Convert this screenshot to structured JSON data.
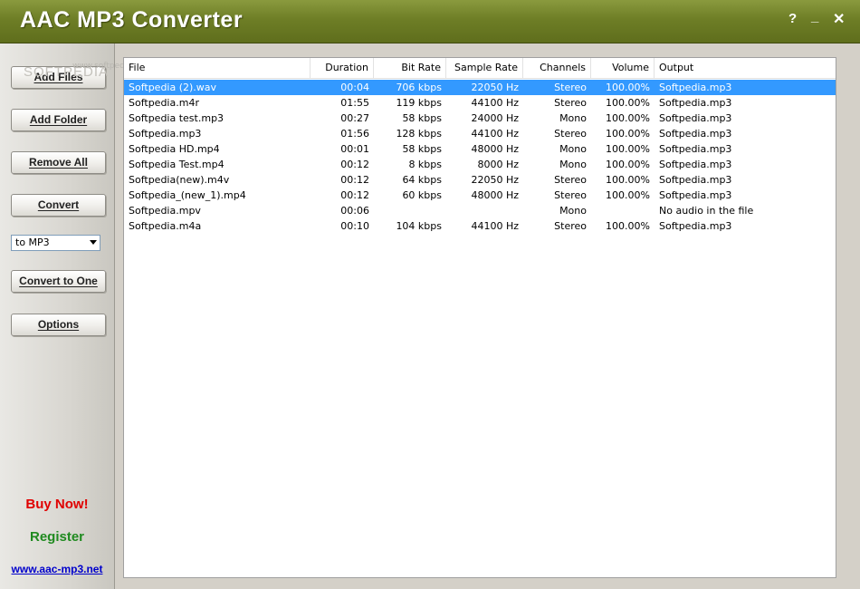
{
  "window": {
    "title": "AAC MP3 Converter",
    "help_label": "?",
    "minimize_label": "_",
    "close_label": "✕"
  },
  "sidebar": {
    "watermark": "SOFTPEDIA",
    "watermark_small": "www.softpedia.com",
    "buttons": {
      "add_files": "Add Files",
      "add_folder": "Add Folder",
      "remove_all": "Remove All",
      "convert": "Convert",
      "convert_to_one": "Convert to One",
      "options": "Options"
    },
    "format_select": {
      "selected": "to MP3"
    },
    "buy_now": "Buy Now!",
    "register": "Register",
    "website": "www.aac-mp3.net",
    "colors": {
      "buy_now": "#e00000",
      "register": "#1f8a1f",
      "link": "#0000cc"
    }
  },
  "file_list": {
    "columns": {
      "file": "File",
      "duration": "Duration",
      "bit_rate": "Bit Rate",
      "sample_rate": "Sample Rate",
      "channels": "Channels",
      "volume": "Volume",
      "output": "Output"
    },
    "rows": [
      {
        "file": "Softpedia (2).wav",
        "duration": "00:04",
        "bit_rate": "706 kbps",
        "sample_rate": "22050 Hz",
        "channels": "Stereo",
        "volume": "100.00%",
        "output": "Softpedia.mp3"
      },
      {
        "file": "Softpedia.m4r",
        "duration": "01:55",
        "bit_rate": "119 kbps",
        "sample_rate": "44100 Hz",
        "channels": "Stereo",
        "volume": "100.00%",
        "output": "Softpedia.mp3"
      },
      {
        "file": "Softpedia test.mp3",
        "duration": "00:27",
        "bit_rate": "58 kbps",
        "sample_rate": "24000 Hz",
        "channels": "Mono",
        "volume": "100.00%",
        "output": "Softpedia.mp3"
      },
      {
        "file": "Softpedia.mp3",
        "duration": "01:56",
        "bit_rate": "128 kbps",
        "sample_rate": "44100 Hz",
        "channels": "Stereo",
        "volume": "100.00%",
        "output": "Softpedia.mp3"
      },
      {
        "file": "Softpedia HD.mp4",
        "duration": "00:01",
        "bit_rate": "58 kbps",
        "sample_rate": "48000 Hz",
        "channels": "Mono",
        "volume": "100.00%",
        "output": "Softpedia.mp3"
      },
      {
        "file": "Softpedia Test.mp4",
        "duration": "00:12",
        "bit_rate": "8 kbps",
        "sample_rate": "8000 Hz",
        "channels": "Mono",
        "volume": "100.00%",
        "output": "Softpedia.mp3"
      },
      {
        "file": "Softpedia(new).m4v",
        "duration": "00:12",
        "bit_rate": "64 kbps",
        "sample_rate": "22050 Hz",
        "channels": "Stereo",
        "volume": "100.00%",
        "output": "Softpedia.mp3"
      },
      {
        "file": "Softpedia_(new_1).mp4",
        "duration": "00:12",
        "bit_rate": "60 kbps",
        "sample_rate": "48000 Hz",
        "channels": "Stereo",
        "volume": "100.00%",
        "output": "Softpedia.mp3"
      },
      {
        "file": "Softpedia.mpv",
        "duration": "00:06",
        "bit_rate": "",
        "sample_rate": "",
        "channels": "Mono",
        "volume": "",
        "output": "No audio in the file"
      },
      {
        "file": "Softpedia.m4a",
        "duration": "00:10",
        "bit_rate": "104 kbps",
        "sample_rate": "44100 Hz",
        "channels": "Stereo",
        "volume": "100.00%",
        "output": "Softpedia.mp3"
      }
    ],
    "selected_row": 0,
    "selection_color": "#3399ff"
  }
}
